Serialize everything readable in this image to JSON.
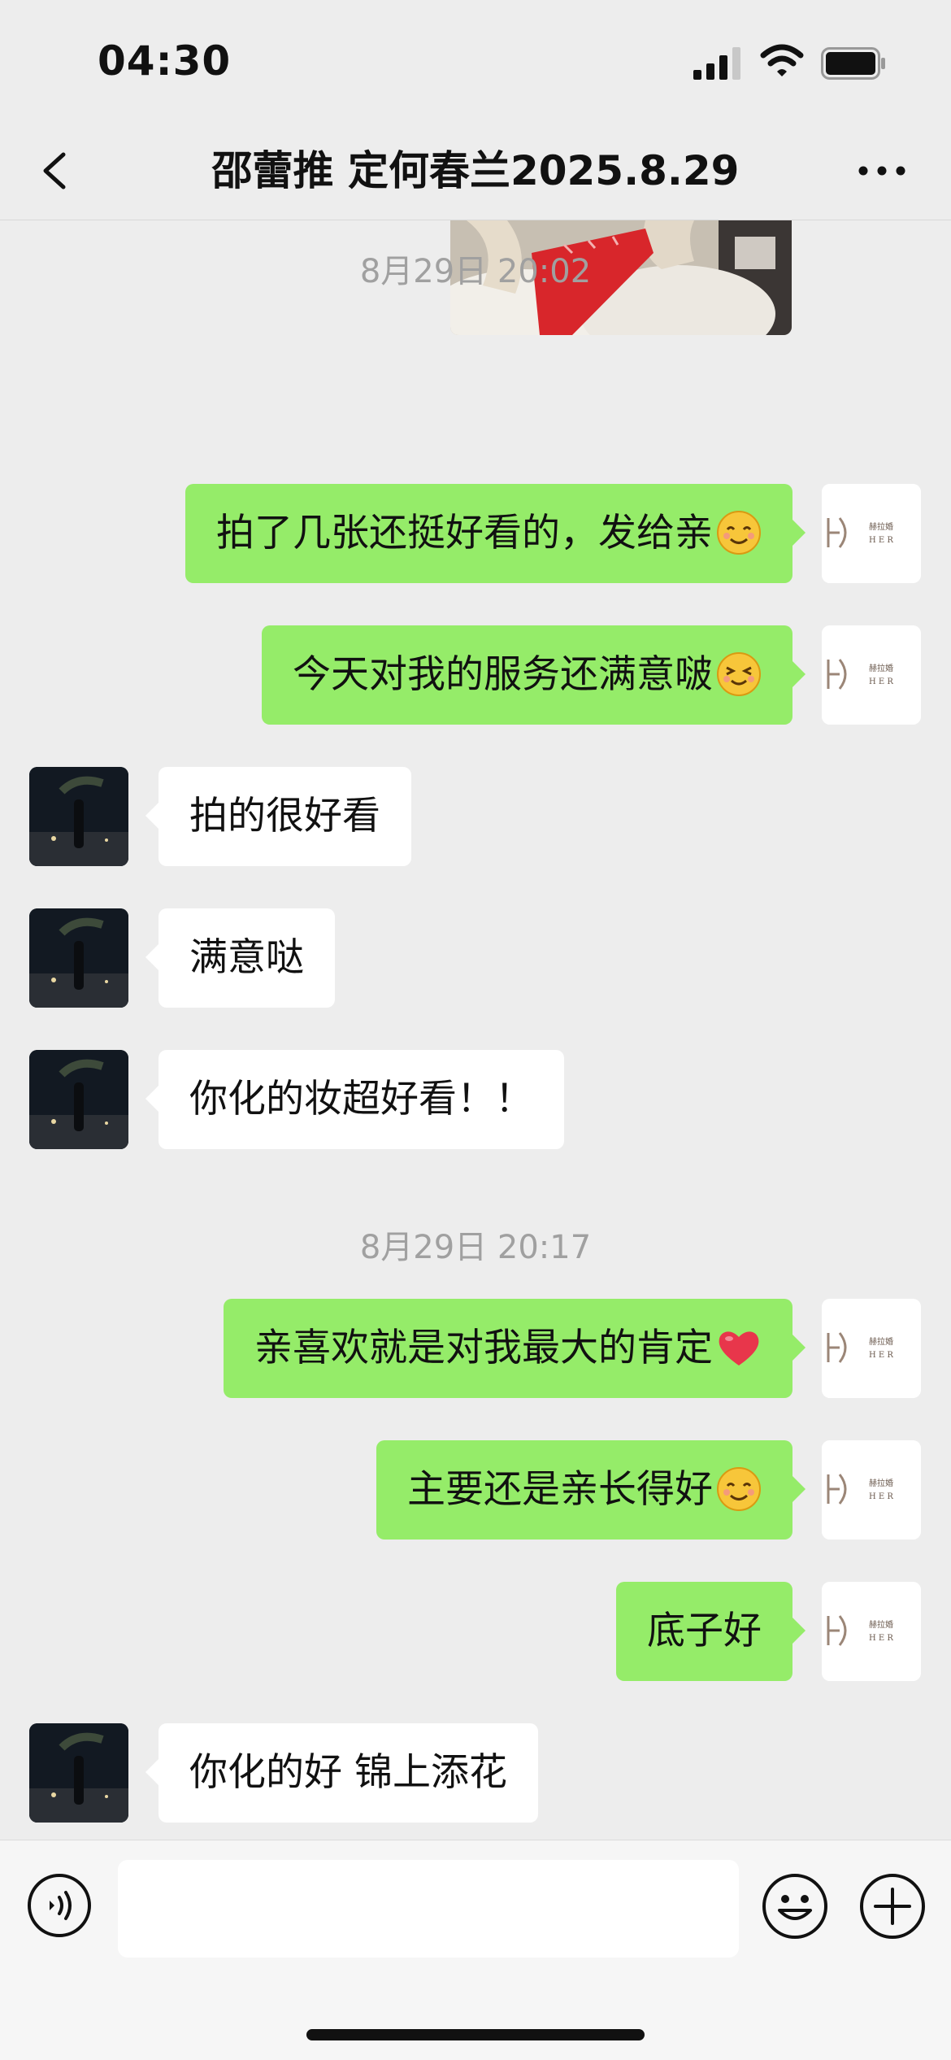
{
  "status_bar": {
    "time": "04:30"
  },
  "nav": {
    "title": "邵蕾推 定何春兰2025.8.29"
  },
  "timestamps": [
    "8月29日 20:02",
    "8月29日 20:17"
  ],
  "messages": [
    {
      "side": "me",
      "text": "拍了几张还挺好看的，发给亲",
      "emoji": "smiling-face-emoji"
    },
    {
      "side": "me",
      "text": "今天对我的服务还满意啵",
      "emoji": "grinning-squint-emoji"
    },
    {
      "side": "other",
      "text": "拍的很好看"
    },
    {
      "side": "other",
      "text": "满意哒"
    },
    {
      "side": "other",
      "text": "你化的妆超好看！！"
    },
    {
      "side": "me",
      "text": "亲喜欢就是对我最大的肯定",
      "emoji": "red-heart-emoji"
    },
    {
      "side": "me",
      "text": "主要还是亲长得好",
      "emoji": "smiling-face-emoji"
    },
    {
      "side": "me",
      "text": "底子好"
    },
    {
      "side": "other",
      "text": "你化的好 锦上添花"
    }
  ],
  "colors": {
    "background": "#ededed",
    "my_bubble": "#95ec69",
    "their_bubble": "#ffffff",
    "timestamp_text": "#a0a0a0"
  },
  "input": {
    "placeholder": ""
  }
}
